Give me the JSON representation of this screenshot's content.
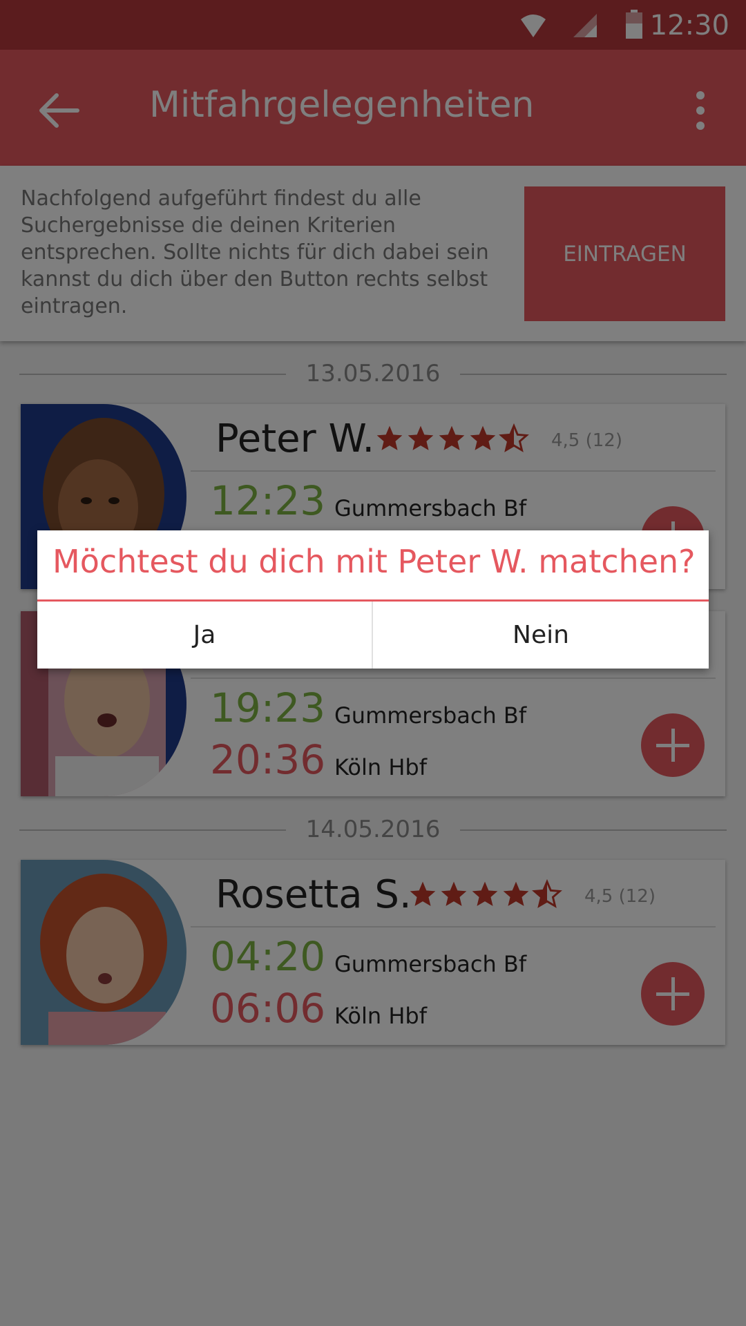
{
  "status_bar": {
    "time": "12:30",
    "icons": [
      "wifi-icon",
      "signal-icon",
      "battery-icon"
    ]
  },
  "app_bar": {
    "title": "Mitfahrgelegenheiten",
    "back_icon": "arrow-left-icon",
    "menu_icon": "more-vert-icon"
  },
  "intro": {
    "text": "Nachfolgend aufgeführt findest du alle Suchergebnisse die deinen Kriterien entsprechen. Sollte nichts für dich dabei sein kannst du dich über den Button rechts selbst eintragen.",
    "button_label": "EINTRAGEN"
  },
  "dates": [
    "13.05.2016",
    "14.05.2016"
  ],
  "rides": [
    {
      "name": "Peter W.",
      "stars": 4.5,
      "rating_text": "4,5 (12)",
      "departure_time": "12:23",
      "departure_station": "Gummersbach Bf",
      "arrival_time": "",
      "arrival_station": ""
    },
    {
      "name": "",
      "stars": 0,
      "rating_text": "",
      "departure_time": "19:23",
      "departure_station": "Gummersbach Bf",
      "arrival_time": "20:36",
      "arrival_station": "Köln Hbf"
    },
    {
      "name": "Rosetta S.",
      "stars": 4.5,
      "rating_text": "4,5 (12)",
      "departure_time": "04:20",
      "departure_station": "Gummersbach Bf",
      "arrival_time": "06:06",
      "arrival_station": "Köln Hbf"
    }
  ],
  "dialog": {
    "message": "Möchtest du dich mit Peter W. matchen?",
    "yes_label": "Ja",
    "no_label": "Nein"
  },
  "colors": {
    "primary": "#e5585f",
    "primary_dark": "#b7383d",
    "departure": "#7cb342",
    "arrival": "#e5585f"
  }
}
